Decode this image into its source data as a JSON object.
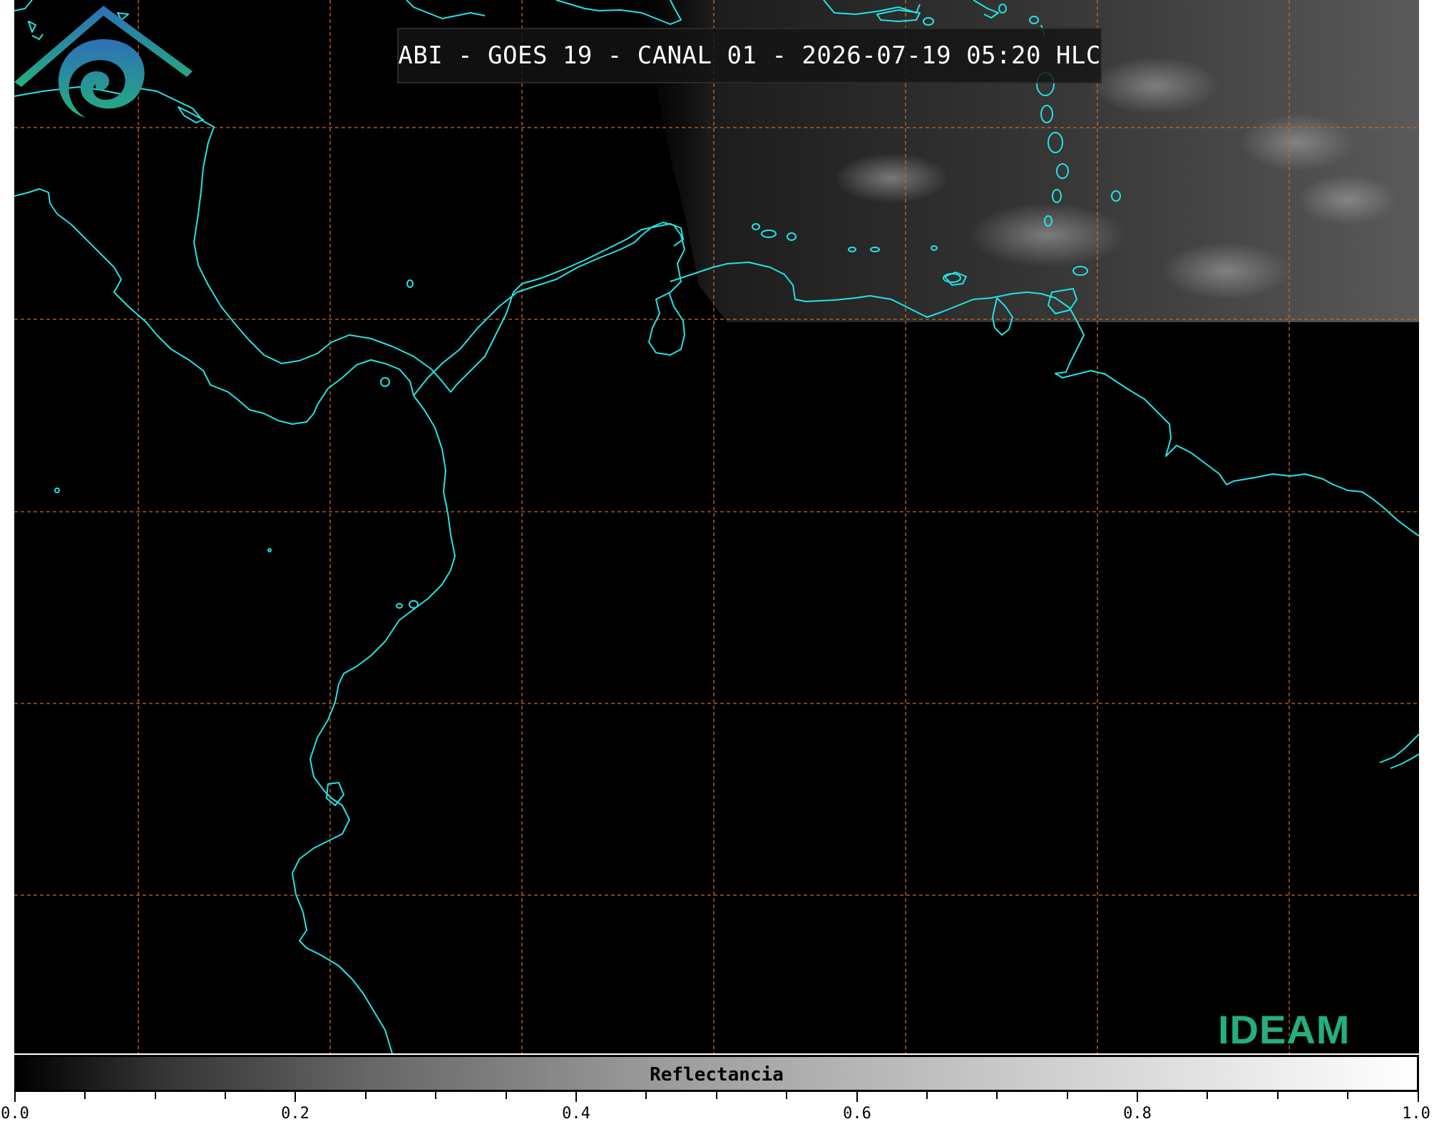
{
  "title": "ABI - GOES 19 - CANAL 01 - 2026-07-19 05:20 HLC",
  "logo": {
    "text": "IDEAM",
    "icon": "ideam-logo-icon"
  },
  "colorbar": {
    "label": "Reflectancia",
    "ticks": [
      "0.0",
      "0.2",
      "0.4",
      "0.6",
      "0.8",
      "1.0"
    ]
  },
  "colors": {
    "coastline": "#25e3e3",
    "grid": "#d2691e",
    "background": "#000000",
    "logo_blue": "#2e6fb8",
    "logo_green": "#23b07d"
  }
}
